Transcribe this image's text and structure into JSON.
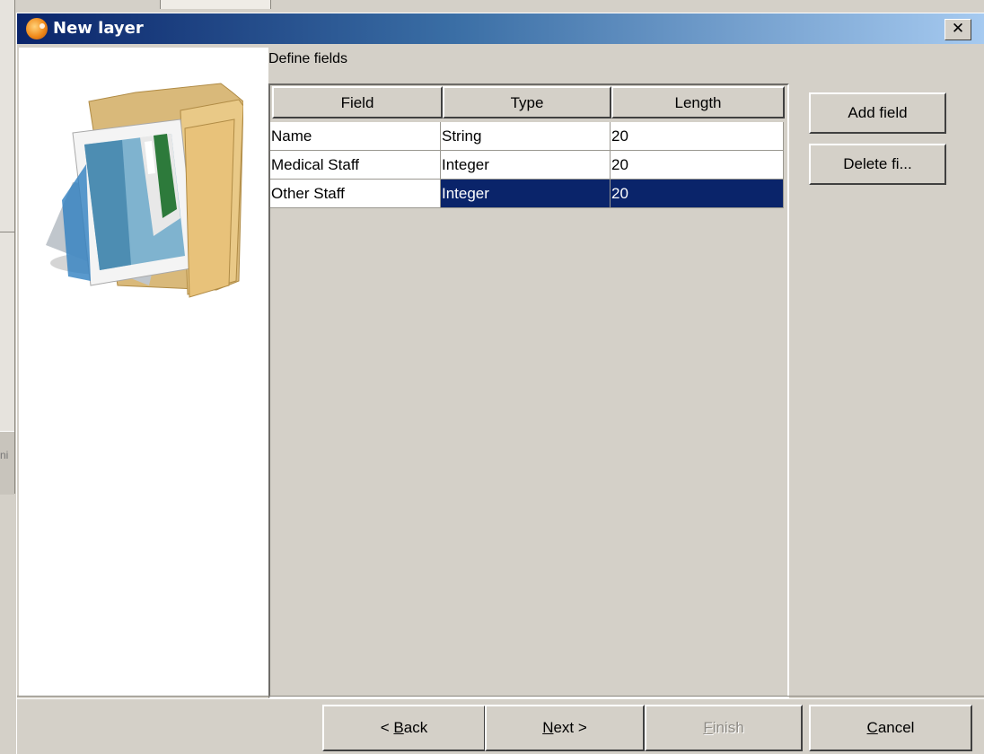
{
  "dialog": {
    "title": "New layer",
    "close_glyph": "✕"
  },
  "background": {
    "edge_text": "ni"
  },
  "fields_panel": {
    "label": "Define fields",
    "columns": [
      "Field",
      "Type",
      "Length"
    ],
    "rows": [
      {
        "field": "Name",
        "type": "String",
        "length": "20",
        "selected": false
      },
      {
        "field": "Medical Staff",
        "type": "Integer",
        "length": "20",
        "selected": false
      },
      {
        "field": "Other Staff",
        "type": "Integer",
        "length": "20",
        "selected": true
      }
    ]
  },
  "side_buttons": {
    "add_field": "Add field",
    "delete_field": "Delete fi..."
  },
  "footer": {
    "back": {
      "prefix": "< ",
      "mnemonic": "B",
      "rest": "ack"
    },
    "next": {
      "mnemonic": "N",
      "rest": "ext >"
    },
    "finish": {
      "mnemonic": "F",
      "rest": "inish"
    },
    "cancel": {
      "mnemonic": "C",
      "rest": "ancel"
    }
  },
  "colors": {
    "selection": "#0a246a",
    "titlebar_start": "#0a246a",
    "titlebar_end": "#a6caf0",
    "face": "#d4d0c8"
  },
  "icons": {
    "title": "gvsig-app-icon",
    "side_art": "folder-with-map-icon"
  }
}
